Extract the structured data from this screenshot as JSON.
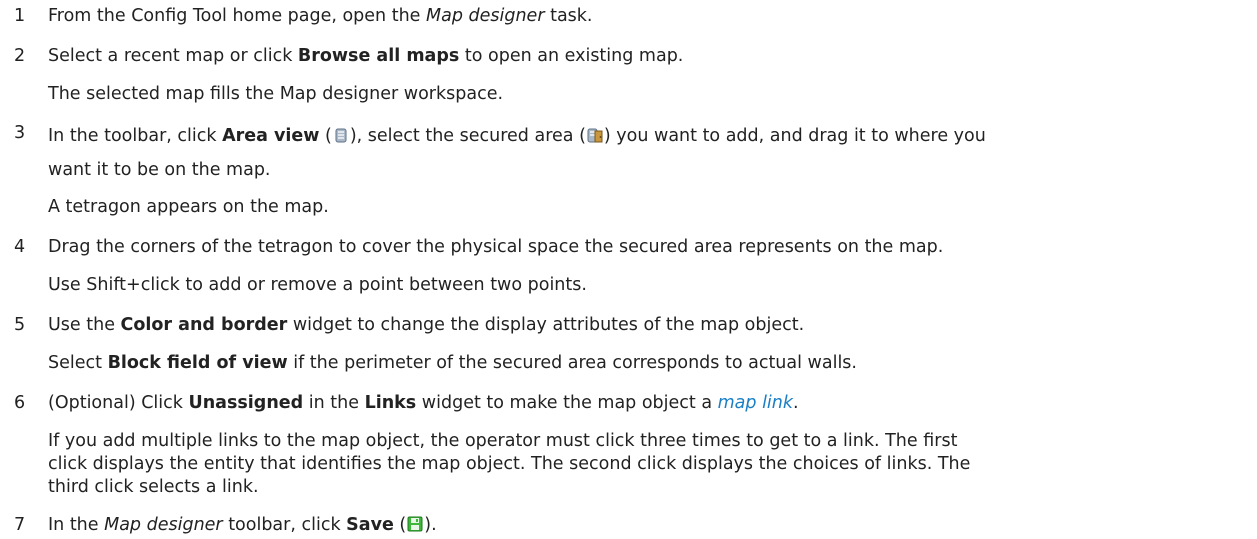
{
  "steps": [
    {
      "num": "1",
      "parts": [
        "From the Config Tool home page, open the ",
        "Map designer",
        " task."
      ]
    },
    {
      "num": "2",
      "parts": [
        "Select a recent map or click ",
        "Browse all maps",
        " to open an existing map."
      ],
      "note": "The selected map fills the Map designer workspace."
    },
    {
      "num": "3",
      "parts": [
        "In the toolbar, click ",
        "Area view",
        " (",
        "), select the secured area (",
        ") you want to add, and drag it to where you",
        "want it to be on the map."
      ],
      "note": "A tetragon appears on the map."
    },
    {
      "num": "4",
      "parts": [
        "Drag the corners of the tetragon to cover the physical space the secured area represents on the map."
      ],
      "note": "Use Shift+click to add or remove a point between two points."
    },
    {
      "num": "5",
      "parts": [
        "Use the ",
        "Color and border",
        " widget to change the display attributes of the map object."
      ],
      "note_parts": [
        "Select ",
        "Block field of view",
        " if the perimeter of the secured area corresponds to actual walls."
      ]
    },
    {
      "num": "6",
      "parts": [
        "(Optional) Click ",
        "Unassigned",
        " in the ",
        "Links",
        " widget to make the map object a ",
        "map link",
        "."
      ],
      "note_lines": [
        "If you add multiple links to the map object, the operator must click three times to get to a link. The first",
        "click displays the entity that identifies the map object. The second click displays the choices of links. The",
        "third click selects a link."
      ]
    },
    {
      "num": "7",
      "parts": [
        "In the ",
        "Map designer",
        " toolbar, click ",
        "Save",
        " (",
        ")."
      ]
    }
  ],
  "icons": {
    "area_view": "area-view-icon",
    "secured_area": "secured-area-icon",
    "save": "save-icon"
  }
}
